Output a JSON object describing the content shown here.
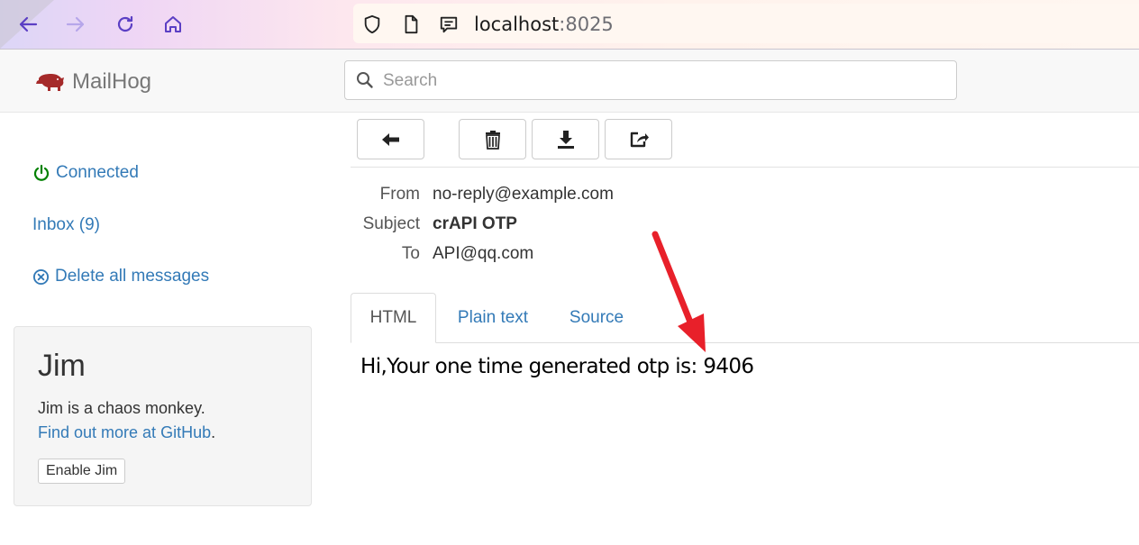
{
  "browser": {
    "url_host": "localhost",
    "url_port": ":8025",
    "icons": [
      "back-arrow-icon",
      "forward-arrow-icon",
      "reload-icon",
      "home-icon",
      "shield-icon",
      "page-icon",
      "reader-icon"
    ]
  },
  "app": {
    "brand_name": "MailHog",
    "search_placeholder": "Search"
  },
  "sidebar": {
    "connected_label": "Connected",
    "inbox_label": "Inbox (9)",
    "delete_all_label": "Delete all messages",
    "jim": {
      "title": "Jim",
      "description": "Jim is a chaos monkey.",
      "more_link": "Find out more at GitHub",
      "more_suffix": ".",
      "enable_button": "Enable Jim"
    }
  },
  "toolbar": {
    "icons": [
      "back-arrow-icon",
      "trash-icon",
      "download-icon",
      "share-icon"
    ]
  },
  "message": {
    "from_label": "From",
    "from_value": "no-reply@example.com",
    "subject_label": "Subject",
    "subject_value": "crAPI OTP",
    "to_label": "To",
    "to_value": "API@qq.com",
    "tabs": [
      {
        "label": "HTML",
        "active": true
      },
      {
        "label": "Plain text",
        "active": false
      },
      {
        "label": "Source",
        "active": false
      }
    ],
    "body": "Hi,Your one time generated otp is: 9406"
  },
  "colors": {
    "link": "#337ab7",
    "connected": "#008000",
    "brand_pig": "#a52a2a",
    "annotation_arrow": "#e8202a"
  }
}
